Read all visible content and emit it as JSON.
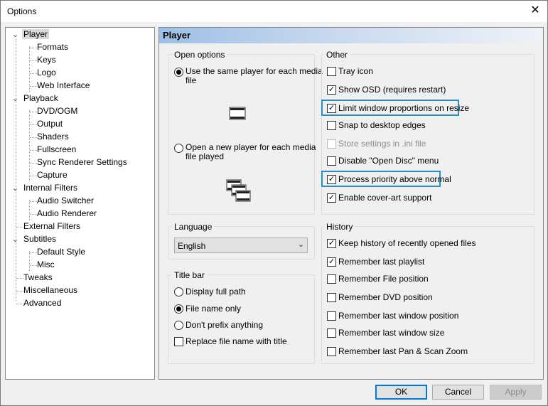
{
  "window": {
    "title": "Options"
  },
  "tree": [
    {
      "label": "Player",
      "selected": true
    },
    {
      "label": "Formats"
    },
    {
      "label": "Keys"
    },
    {
      "label": "Logo"
    },
    {
      "label": "Web Interface"
    },
    {
      "label": "Playback"
    },
    {
      "label": "DVD/OGM"
    },
    {
      "label": "Output"
    },
    {
      "label": "Shaders"
    },
    {
      "label": "Fullscreen"
    },
    {
      "label": "Sync Renderer Settings"
    },
    {
      "label": "Capture"
    },
    {
      "label": "Internal Filters"
    },
    {
      "label": "Audio Switcher"
    },
    {
      "label": "Audio Renderer"
    },
    {
      "label": "External Filters"
    },
    {
      "label": "Subtitles"
    },
    {
      "label": "Default Style"
    },
    {
      "label": "Misc"
    },
    {
      "label": "Tweaks"
    },
    {
      "label": "Miscellaneous"
    },
    {
      "label": "Advanced"
    }
  ],
  "page": {
    "title": "Player"
  },
  "open_options": {
    "title": "Open options",
    "same_player": {
      "label1": "Use the same player for each media",
      "label2": "file",
      "selected": true
    },
    "new_player": {
      "label1": "Open a new player for each media",
      "label2": "file played",
      "selected": false
    }
  },
  "language": {
    "title": "Language",
    "selected": "English"
  },
  "title_bar": {
    "title": "Title bar",
    "options": [
      {
        "label": "Display full path",
        "selected": false
      },
      {
        "label": "File name only",
        "selected": true
      },
      {
        "label": "Don't prefix anything",
        "selected": false
      }
    ],
    "replace_label": "Replace file name with title",
    "replace_checked": false
  },
  "other": {
    "title": "Other",
    "items": [
      {
        "label": "Tray icon",
        "checked": false
      },
      {
        "label": "Show OSD (requires restart)",
        "checked": true
      },
      {
        "label": "Limit window proportions on resize",
        "checked": true,
        "highlight": true
      },
      {
        "label": "Snap to desktop edges",
        "checked": false
      },
      {
        "label": "Store settings in .ini file",
        "checked": false,
        "disabled": true
      },
      {
        "label": "Disable \"Open Disc\" menu",
        "checked": false
      },
      {
        "label": "Process priority above normal",
        "checked": true,
        "highlight": true
      },
      {
        "label": "Enable cover-art support",
        "checked": true
      }
    ]
  },
  "history": {
    "title": "History",
    "items": [
      {
        "label": "Keep history of recently opened files",
        "checked": true
      },
      {
        "label": "Remember last playlist",
        "checked": true
      },
      {
        "label": "Remember File position",
        "checked": false
      },
      {
        "label": "Remember DVD position",
        "checked": false
      },
      {
        "label": "Remember last window position",
        "checked": false
      },
      {
        "label": "Remember last window size",
        "checked": false
      },
      {
        "label": "Remember last Pan & Scan Zoom",
        "checked": false
      }
    ]
  },
  "buttons": {
    "ok": "OK",
    "cancel": "Cancel",
    "apply": "Apply"
  },
  "colors": {
    "highlight": "#2a8dc4",
    "header_gradient_start": "#9ebfe6"
  }
}
